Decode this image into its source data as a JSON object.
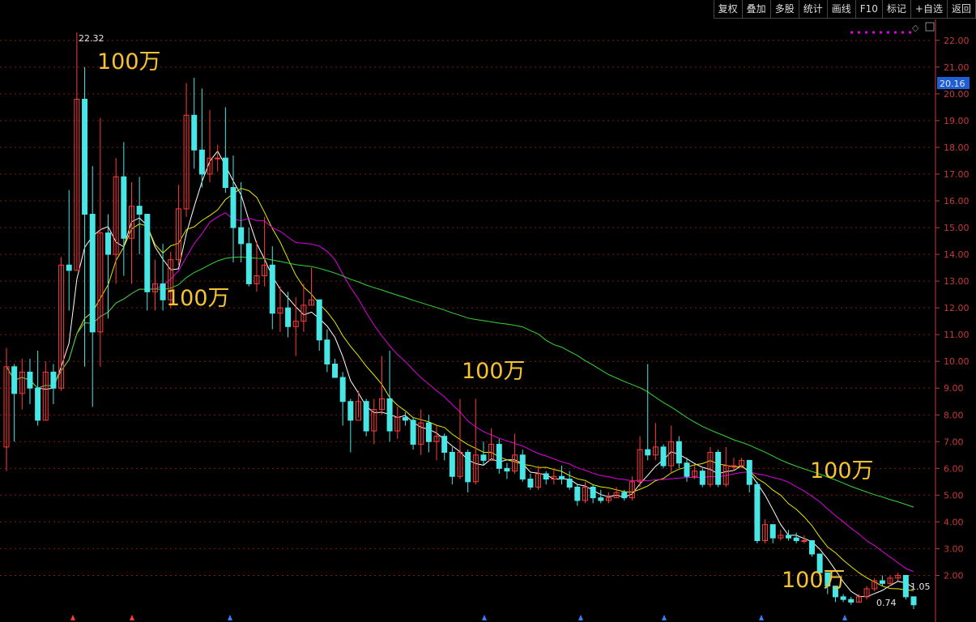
{
  "toolbar": {
    "buttons": [
      "复权",
      "叠加",
      "多股",
      "统计",
      "画线",
      "F10",
      "标记",
      "+自选",
      "返回"
    ]
  },
  "overlay_texts": [
    "100万",
    "100万",
    "100万",
    "100万",
    "100万"
  ],
  "price_marker": {
    "value": "20.16",
    "color": "#1f5fd6"
  },
  "max_label": "22.32",
  "min_label": "0.74",
  "last_label": "1.05",
  "colors": {
    "up": "#ff3b3b",
    "down": "#49e6e6",
    "ma5": "#ffffff",
    "ma10": "#e8e800",
    "ma20": "#e000e0",
    "ma60": "#35d635",
    "grid": "#7a1a1a",
    "axis": "#c63a3a"
  },
  "chart_data": {
    "type": "candlestick",
    "y_axis": {
      "min": 0.5,
      "max": 22.6,
      "ticks": [
        "2.00",
        "3.00",
        "4.00",
        "5.00",
        "6.00",
        "7.00",
        "8.00",
        "9.00",
        "10.00",
        "11.00",
        "12.00",
        "13.00",
        "14.00",
        "15.00",
        "16.00",
        "17.00",
        "18.00",
        "19.00",
        "20.00",
        "21.00",
        "22.00"
      ]
    },
    "candles": [
      [
        6.8,
        9.8,
        10.5,
        5.9
      ],
      [
        9.8,
        8.8,
        9.9,
        7.0
      ],
      [
        8.8,
        9.6,
        10.1,
        8.2
      ],
      [
        9.6,
        9.0,
        10.1,
        8.4
      ],
      [
        9.0,
        7.8,
        10.4,
        7.6
      ],
      [
        7.8,
        9.6,
        10.0,
        7.8
      ],
      [
        9.6,
        9.0,
        9.9,
        8.4
      ],
      [
        9.0,
        13.6,
        13.9,
        8.9
      ],
      [
        13.6,
        13.4,
        16.4,
        11.9
      ],
      [
        13.4,
        19.8,
        22.3,
        13.4
      ],
      [
        19.8,
        15.5,
        21.0,
        9.8
      ],
      [
        15.5,
        11.1,
        17.3,
        8.3
      ],
      [
        11.1,
        14.8,
        19.1,
        9.8
      ],
      [
        14.8,
        14.0,
        15.5,
        11.6
      ],
      [
        14.0,
        16.9,
        17.6,
        12.9
      ],
      [
        16.9,
        14.6,
        18.2,
        13.2
      ],
      [
        14.6,
        15.8,
        16.7,
        12.9
      ],
      [
        15.8,
        15.5,
        16.9,
        14.0
      ],
      [
        15.5,
        12.6,
        14.9,
        11.9
      ],
      [
        12.6,
        12.9,
        13.8,
        11.9
      ],
      [
        12.9,
        12.3,
        14.4,
        11.9
      ],
      [
        12.3,
        13.8,
        14.1,
        12.0
      ],
      [
        13.8,
        15.7,
        16.6,
        13.6
      ],
      [
        15.7,
        19.2,
        20.4,
        15.4
      ],
      [
        19.2,
        17.9,
        20.6,
        17.2
      ],
      [
        17.9,
        17.0,
        20.2,
        16.5
      ],
      [
        17.0,
        17.6,
        19.4,
        16.7
      ],
      [
        17.6,
        17.6,
        18.1,
        17.1
      ],
      [
        17.6,
        16.5,
        19.5,
        16.3
      ],
      [
        16.5,
        15.0,
        17.7,
        13.7
      ],
      [
        15.0,
        14.4,
        16.7,
        13.7
      ],
      [
        14.4,
        12.9,
        15.0,
        12.8
      ],
      [
        12.9,
        13.2,
        14.5,
        12.6
      ],
      [
        13.2,
        13.6,
        15.4,
        12.8
      ],
      [
        13.6,
        11.8,
        14.3,
        11.2
      ],
      [
        11.8,
        12.0,
        12.8,
        11.1
      ],
      [
        12.0,
        11.3,
        12.6,
        10.9
      ],
      [
        11.3,
        11.5,
        12.4,
        10.2
      ],
      [
        11.5,
        12.1,
        12.9,
        11.1
      ],
      [
        12.1,
        12.3,
        13.5,
        12.1
      ],
      [
        12.3,
        10.8,
        12.3,
        10.4
      ],
      [
        10.8,
        9.9,
        11.2,
        9.6
      ],
      [
        9.9,
        9.4,
        10.1,
        9.4
      ],
      [
        9.4,
        8.5,
        9.6,
        7.6
      ],
      [
        8.5,
        7.8,
        8.6,
        6.6
      ],
      [
        7.8,
        8.5,
        8.9,
        7.9
      ],
      [
        8.5,
        7.4,
        8.6,
        7.2
      ],
      [
        7.4,
        8.2,
        8.6,
        6.9
      ],
      [
        8.2,
        8.6,
        10.2,
        8.0
      ],
      [
        8.6,
        7.4,
        10.4,
        7.0
      ],
      [
        7.4,
        7.9,
        8.3,
        7.1
      ],
      [
        7.9,
        7.8,
        8.1,
        7.6
      ],
      [
        7.8,
        6.9,
        7.9,
        6.7
      ],
      [
        6.9,
        7.7,
        8.2,
        6.5
      ],
      [
        7.7,
        7.0,
        8.0,
        6.6
      ],
      [
        7.0,
        7.2,
        7.6,
        6.3
      ],
      [
        7.2,
        6.6,
        7.3,
        6.3
      ],
      [
        6.6,
        5.7,
        6.8,
        5.4
      ],
      [
        5.7,
        6.6,
        8.6,
        5.6
      ],
      [
        6.6,
        5.5,
        6.7,
        5.1
      ],
      [
        5.5,
        6.5,
        8.6,
        5.4
      ],
      [
        6.5,
        6.3,
        7.0,
        6.1
      ],
      [
        6.3,
        6.9,
        7.5,
        6.4
      ],
      [
        6.9,
        6.0,
        7.1,
        5.8
      ],
      [
        6.0,
        5.9,
        6.2,
        5.6
      ],
      [
        5.9,
        6.5,
        7.3,
        5.8
      ],
      [
        6.5,
        5.6,
        6.7,
        5.5
      ],
      [
        5.6,
        5.3,
        5.8,
        5.2
      ],
      [
        5.3,
        5.8,
        6.1,
        5.2
      ],
      [
        5.8,
        5.6,
        5.9,
        5.4
      ],
      [
        5.6,
        5.7,
        6.0,
        5.4
      ],
      [
        5.7,
        5.6,
        6.1,
        5.4
      ],
      [
        5.6,
        5.3,
        5.9,
        5.2
      ],
      [
        5.3,
        4.8,
        5.4,
        4.6
      ],
      [
        4.8,
        5.3,
        5.5,
        4.7
      ],
      [
        5.3,
        4.9,
        5.4,
        4.7
      ],
      [
        4.9,
        4.8,
        5.2,
        4.7
      ],
      [
        4.8,
        4.9,
        5.1,
        4.7
      ],
      [
        4.9,
        5.1,
        5.3,
        4.9
      ],
      [
        5.1,
        4.9,
        5.2,
        4.8
      ],
      [
        4.9,
        5.5,
        5.7,
        4.8
      ],
      [
        5.5,
        6.7,
        7.2,
        5.3
      ],
      [
        6.7,
        6.5,
        9.9,
        6.3
      ],
      [
        6.5,
        6.8,
        7.7,
        6.3
      ],
      [
        6.8,
        6.1,
        6.9,
        6.0
      ],
      [
        6.1,
        7.0,
        7.6,
        5.8
      ],
      [
        7.0,
        6.2,
        7.2,
        6.0
      ],
      [
        6.2,
        5.7,
        6.4,
        5.5
      ],
      [
        5.7,
        5.9,
        6.1,
        5.6
      ],
      [
        5.9,
        5.4,
        6.0,
        5.3
      ],
      [
        5.4,
        6.6,
        6.8,
        5.3
      ],
      [
        6.6,
        5.4,
        6.7,
        5.3
      ],
      [
        5.4,
        6.1,
        6.8,
        5.3
      ],
      [
        6.1,
        6.1,
        6.4,
        5.9
      ],
      [
        6.1,
        6.3,
        6.4,
        6.0
      ],
      [
        6.3,
        5.4,
        6.3,
        5.1
      ],
      [
        5.4,
        3.3,
        5.5,
        3.2
      ],
      [
        3.3,
        3.9,
        4.1,
        3.2
      ],
      [
        3.9,
        3.4,
        3.6,
        3.2
      ],
      [
        3.4,
        3.5,
        3.7,
        3.3
      ],
      [
        3.5,
        3.4,
        3.7,
        3.3
      ],
      [
        3.4,
        3.3,
        3.6,
        3.2
      ],
      [
        3.3,
        3.3,
        3.5,
        3.2
      ],
      [
        3.3,
        2.8,
        3.1,
        2.7
      ],
      [
        2.8,
        2.1,
        2.5,
        1.8
      ],
      [
        2.1,
        1.6,
        1.8,
        1.3
      ],
      [
        1.6,
        1.2,
        1.4,
        1.0
      ],
      [
        1.2,
        1.1,
        1.3,
        1.0
      ],
      [
        1.1,
        1.0,
        1.2,
        0.9
      ],
      [
        1.0,
        1.2,
        1.3,
        1.0
      ],
      [
        1.2,
        1.5,
        1.6,
        1.1
      ],
      [
        1.5,
        1.8,
        1.9,
        1.4
      ],
      [
        1.8,
        1.7,
        2.0,
        1.6
      ],
      [
        1.7,
        1.9,
        2.0,
        1.6
      ],
      [
        1.9,
        2.0,
        2.1,
        1.8
      ],
      [
        2.0,
        1.2,
        1.3,
        1.1
      ],
      [
        1.2,
        0.9,
        1.05,
        0.74
      ]
    ],
    "moving_averages": [
      {
        "name": "MA5",
        "period": 5
      },
      {
        "name": "MA10",
        "period": 10
      },
      {
        "name": "MA20",
        "period": 20
      },
      {
        "name": "MA60",
        "period": 60
      }
    ]
  }
}
